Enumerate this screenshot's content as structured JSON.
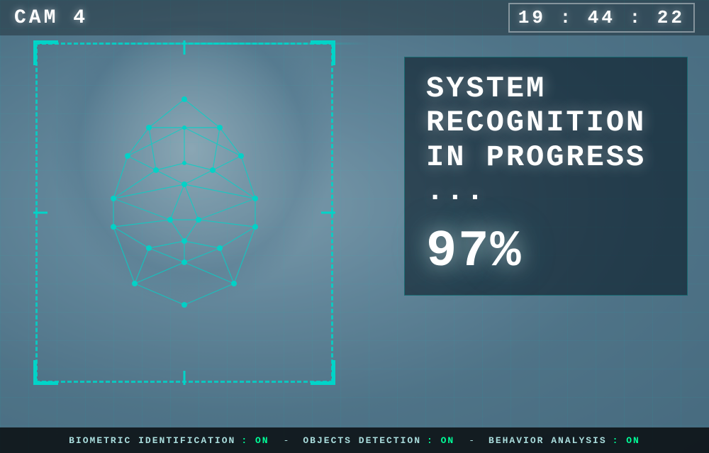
{
  "screen": {
    "cam_label": "CAM 4",
    "timestamp": "19 : 44 : 22",
    "recognition": {
      "line1": "SYSTEM",
      "line2": "RECOGNITION",
      "line3": "IN PROGRESS ...",
      "percentage": "97%"
    },
    "status_bar": {
      "item1_label": "BIOMETRIC IDENTIFICATION",
      "item1_value": ": ON",
      "separator1": " - ",
      "item2_label": "OBJECTS DETECTION",
      "item2_value": ": ON",
      "separator2": " - ",
      "item3_label": "BEHAVIOR ANALYSIS",
      "item3_value": ": ON"
    }
  },
  "colors": {
    "accent": "#00d4c8",
    "text_primary": "#ffffff",
    "status_on": "#00ff99",
    "bg_dark": "#0a1520"
  }
}
